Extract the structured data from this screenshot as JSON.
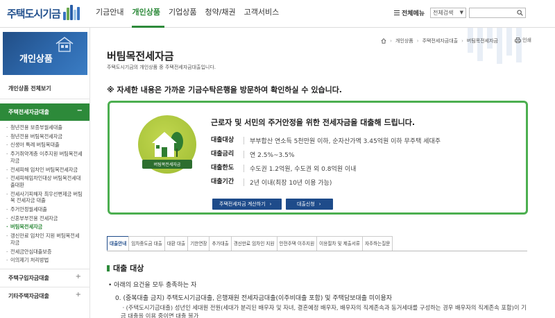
{
  "header": {
    "logo_text": "주택도시기금",
    "nav": [
      "기금안내",
      "개인상품",
      "기업상품",
      "청약/채권",
      "고객서비스"
    ],
    "active_nav": 1,
    "all_menu": "전체메뉴",
    "search_select": "전체검색",
    "search_value": ""
  },
  "lnb": {
    "banner_title": "개인상품",
    "all_link": "개인상품 전체보기",
    "active_group": "주택전세자금대출",
    "sub_items": [
      "청년전용 보증부월세대출",
      "청년전용 버팀목전세자금",
      "신생아 특례 버팀목대출",
      "주거취약계층 이주지원 버팀목전세자금",
      "전세피해 임차인 버팀목전세자금",
      "전세피해임차인대상 버팀목전세대출대환",
      "전세사기피해자 최우선변제금 버팀목 전세자금 대출",
      "주거안정월세대출",
      "신혼부부전용 전세자금",
      "버팀목전세자금",
      "갱신만료 임차인 지원 버팀목전세자금",
      "전세금안심대출보증",
      "이의제기 처리방법"
    ],
    "current_sub": 9,
    "groups": [
      "주택구입자금대출",
      "기타주택자금대출"
    ]
  },
  "content": {
    "breadcrumb": [
      "개인상품",
      "주택전세자금대출",
      "버팀목전세자금"
    ],
    "print_label": "인쇄",
    "title": "버팀목전세자금",
    "desc": "주택도시기금의 개인상품 중 주택전세자금대출입니다.",
    "notice": "※ 자세한 내용은 가까운 기금수탁은행을 방문하여 확인하실 수 있습니다.",
    "summary": {
      "badge_label": "버팀목전세자금",
      "headline": "근로자 및 서민의 주거안정을 위한 전세자금을 대출해 드립니다.",
      "rows": [
        {
          "label": "대출대상",
          "value": "부부합산 연소득 5천만원 이하, 순자산가액 3.45억원 이하 무주택 세대주"
        },
        {
          "label": "대출금리",
          "value": "연 2.5%~3.5%"
        },
        {
          "label": "대출한도",
          "value": "수도권 1.2억원, 수도권 외 0.8억원 이내"
        },
        {
          "label": "대출기간",
          "value": "2년 이내(최장 10년 이용 가능)"
        }
      ],
      "btn_calc": "주택전세자금 계산하기",
      "btn_apply": "대출신청"
    },
    "tabs": [
      "대출안내",
      "임차중도금 대출",
      "대환 대출",
      "기한연장",
      "추가대출",
      "갱신만료 임차인 지원",
      "안전주택 이주지원",
      "이용절차 및 제출서류",
      "자주하는질문"
    ],
    "active_tab": 0,
    "section_title": "대출 대상",
    "requirement": "• 아래의 요건을 모두 충족하는 자",
    "dup_rule": "0. (중복대출 금지) 주택도시기금대출, 은행재원 전세자금대출(이주비대출 포함) 및 주택담보대출 미이용자",
    "detail": "ㆍ(주택도시기금대출) 성년인 세대원 전원(세대가 분리된 배우자 및 자녀, 결혼예정 배우자, 배우자의 직계존속과 동거세대를 구성하는 경우 배우자의 직계존속 포함)이 기금 대출을 이용 중이면 대출 불가"
  },
  "colors": {
    "green": "#2d8a3a",
    "navy": "#1e4b8a",
    "border_green": "#4caf50"
  }
}
